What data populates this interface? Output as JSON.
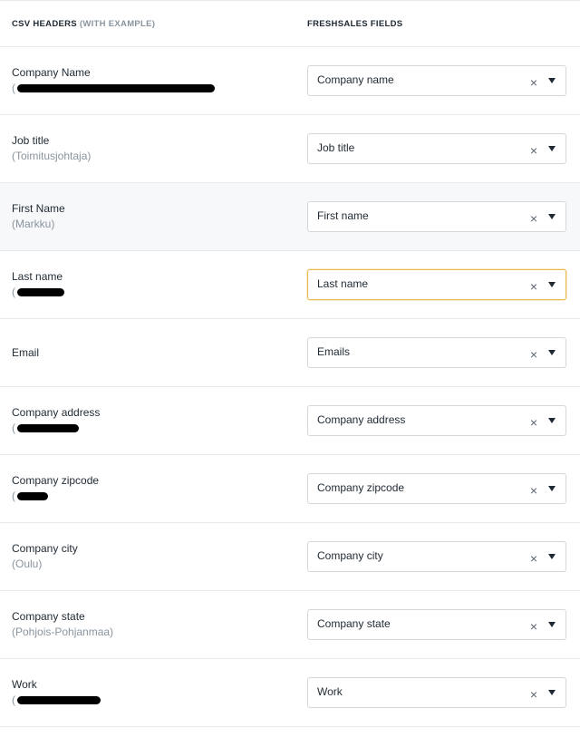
{
  "header": {
    "csv_headers": "CSV HEADERS",
    "with_example": "(WITH EXAMPLE)",
    "freshsales_fields": "FRESHSALES FIELDS"
  },
  "rows": [
    {
      "label": "Company Name",
      "example": "(",
      "redacted": true,
      "field": "Company name"
    },
    {
      "label": "Job title",
      "example": "(Toimitusjohtaja)",
      "redacted": false,
      "field": "Job title"
    },
    {
      "label": "First Name",
      "example": "(Markku)",
      "redacted": false,
      "field": "First name",
      "highlight": true
    },
    {
      "label": "Last name",
      "example": "(",
      "redacted": true,
      "field": "Last name",
      "focused": true
    },
    {
      "label": "Email",
      "example": "",
      "redacted": false,
      "field": "Emails"
    },
    {
      "label": "Company address",
      "example": "(",
      "redacted": true,
      "field": "Company address"
    },
    {
      "label": "Company zipcode",
      "example": "(",
      "redacted": true,
      "field": "Company zipcode"
    },
    {
      "label": "Company city",
      "example": "(Oulu)",
      "redacted": false,
      "field": "Company city"
    },
    {
      "label": "Company state",
      "example": "(Pohjois-Pohjanmaa)",
      "redacted": false,
      "field": "Company state"
    },
    {
      "label": "Work",
      "example": "(",
      "redacted": true,
      "field": "Work"
    }
  ],
  "icons": {
    "clear": "close-icon",
    "dropdown": "caret-down-icon"
  },
  "colors": {
    "focus_border": "#e8b94a",
    "row_highlight": "#f7f8f9"
  }
}
